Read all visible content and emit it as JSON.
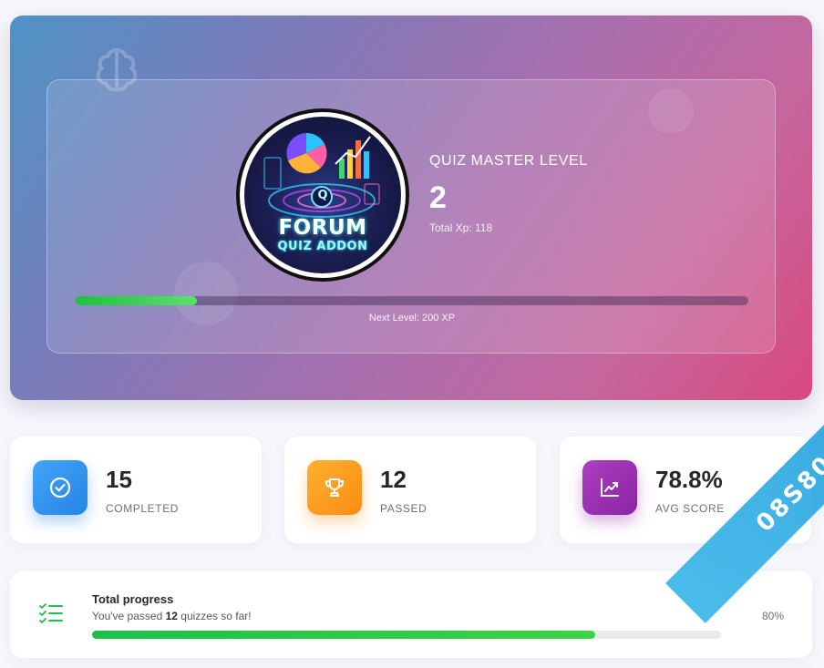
{
  "level": {
    "title": "QUIZ MASTER LEVEL",
    "number": "2",
    "total_xp_text": "Total Xp: 118",
    "next_level_text": "Next Level: 200 XP",
    "xp_progress_fraction": 0.18,
    "logo_line1": "FORUM",
    "logo_line2": "QUIZ ADDON",
    "logo_center_letter": "Q"
  },
  "stats": [
    {
      "value": "15",
      "label": "COMPLETED",
      "icon": "check-circle-icon",
      "color": "#2f8fea"
    },
    {
      "value": "12",
      "label": "PASSED",
      "icon": "trophy-icon",
      "color": "#fd9a1e"
    },
    {
      "value": "78.8%",
      "label": "AVG SCORE",
      "icon": "chart-line-icon",
      "color": "#9a2fb2"
    }
  ],
  "total_progress": {
    "title": "Total progress",
    "subtitle_prefix": "You've passed ",
    "subtitle_count": "12",
    "subtitle_suffix": " quizzes so far!",
    "percent_text": "80%",
    "fraction": 0.8,
    "icon": "list-check-icon"
  },
  "watermark": {
    "text": "08S80"
  },
  "colors": {
    "accent_green": "#1cc04a",
    "hero_gradient_start": "#4f93c6",
    "hero_gradient_end": "#d8497f"
  }
}
